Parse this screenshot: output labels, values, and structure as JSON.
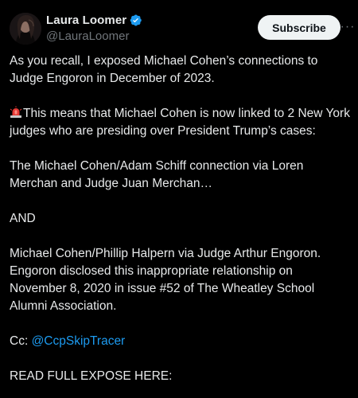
{
  "author": {
    "display_name": "Laura Loomer",
    "handle": "@LauraLoomer",
    "verified": true,
    "avatar_icon": "profile-avatar"
  },
  "actions": {
    "subscribe_label": "Subscribe",
    "more_label": "···"
  },
  "post": {
    "p1": "As you recall, I exposed Michael Cohen’s connections to Judge Engoron in December of 2023.",
    "p2_icon": "police-siren-icon",
    "p2": "This means that Michael Cohen is now linked to 2 New York judges who are presiding over President Trump’s cases:",
    "p3": "The Michael Cohen/Adam Schiff connection via Loren Merchan and Judge Juan Merchan…",
    "p4": "AND",
    "p5": "Michael Cohen/Phillip Halpern via Judge Arthur Engoron. Engoron disclosed this inappropriate relationship  on November 8, 2020 in issue #52 of The Wheatley School Alumni Association.",
    "p6_prefix": "Cc: ",
    "p6_mention": "@CcpSkipTracer",
    "p7": "READ FULL EXPOSE HERE:"
  },
  "colors": {
    "background": "#000000",
    "text": "#e7e9ea",
    "muted": "#71767b",
    "link": "#1d9bf0",
    "verified_badge": "#1d9bf0"
  }
}
